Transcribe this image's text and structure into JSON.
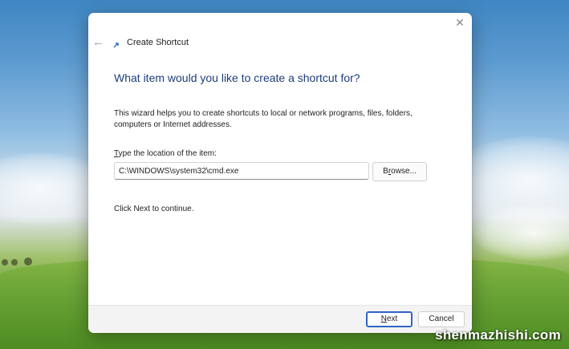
{
  "window": {
    "title": "Create Shortcut",
    "close_glyph": "✕",
    "back_glyph": "←",
    "icon": "shortcut-arrow-icon"
  },
  "wizard": {
    "heading": "What item would you like to create a shortcut for?",
    "description": "This wizard helps you to create shortcuts to local or network programs, files, folders, computers or Internet addresses.",
    "location_label_accel": "T",
    "location_label_rest": "ype the location of the item:",
    "location_value": "C:\\WINDOWS\\system32\\cmd.exe",
    "browse_accel": "r",
    "browse_pre": "B",
    "browse_post": "owse...",
    "continue_text": "Click Next to continue."
  },
  "footer": {
    "next_accel": "N",
    "next_rest": "ext",
    "cancel_label": "Cancel"
  },
  "watermark": "shenmazhishi.com",
  "colors": {
    "heading": "#1e3d7a",
    "next_border": "#2f64c8",
    "footer_bg": "#f3f3f3"
  }
}
